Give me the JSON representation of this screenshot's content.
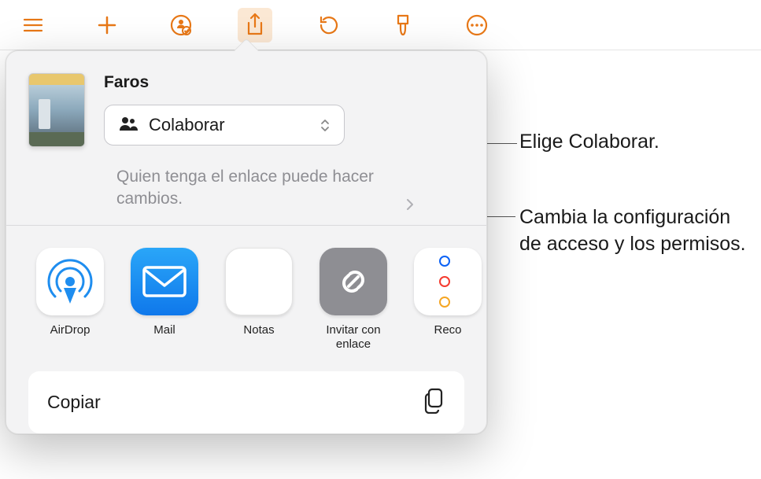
{
  "toolbar": {
    "buttons": [
      "list-icon",
      "add-icon",
      "people-icon",
      "share-icon",
      "undo-icon",
      "brush-icon",
      "more-icon"
    ]
  },
  "document": {
    "title": "Faros"
  },
  "collaborate": {
    "label": "Colaborar"
  },
  "permission": {
    "text": "Quien tenga el enlace puede hacer cambios."
  },
  "apps": [
    {
      "name": "AirDrop",
      "type": "airdrop"
    },
    {
      "name": "Mail",
      "type": "mail"
    },
    {
      "name": "Notas",
      "type": "notes"
    },
    {
      "name": "Invitar con enlace",
      "type": "link"
    },
    {
      "name": "Reco",
      "type": "reminders"
    }
  ],
  "actions": {
    "copy": "Copiar"
  },
  "callouts": {
    "c1": "Elige Colaborar.",
    "c2": "Cambia la configuración de acceso y los permisos."
  }
}
